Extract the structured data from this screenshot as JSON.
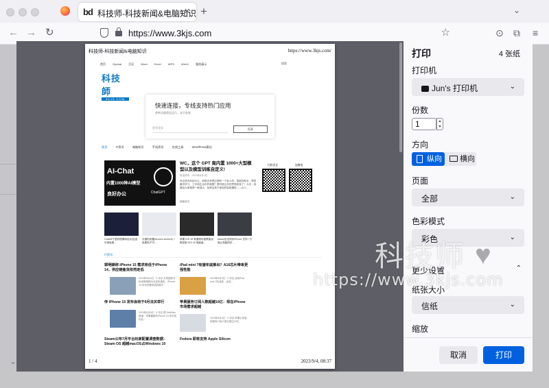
{
  "browser": {
    "tab_title": "科技师-科技新闻&电脑知识",
    "tab_favicon": "bd",
    "tab_close": "×",
    "new_tab": "+",
    "tab_list": "⌄",
    "url": "https://www.3kjs.com",
    "nav": {
      "back": "←",
      "forward": "→",
      "reload": "↻"
    },
    "star": "☆",
    "toolbar_icons": {
      "pocket": "⊙",
      "extensions": "⧉",
      "menu": "≡"
    }
  },
  "preview_page": {
    "header_left": "科技师-科技新闻&电脑知识",
    "header_right": "https://www.3kjs.com/",
    "footer_left": "1 / 4",
    "footer_right": "2023/9/4, 08:37",
    "nav_items": [
      "首页",
      "Openai",
      "日记",
      "Word",
      "Excel",
      "WPS",
      "Win11",
      "服务展示"
    ],
    "search": "搜索",
    "logo_zh": "科技師",
    "logo_en": "3KJS.COM",
    "ad_title": "快速连接，专线支持热门应用",
    "ad_sub": "多种设备稳定运行，永不失联",
    "ad_input": "更多登录",
    "ad_button": "打开",
    "categories": [
      "首页",
      "IT资讯",
      "电脑知识",
      "手机资讯",
      "在线工具",
      "WordPress建站"
    ],
    "featured": {
      "img_big": "AI-Chat",
      "img_mid": "内置1000种AI模型",
      "img_small": "良好办公",
      "img_brand": "ChatGPT",
      "title": "WC，这个 GPT 竟内置 1000+大型模型以及模型训练自定义!",
      "meta": "科技资讯 · 2023年8月4日",
      "desc": "热点资讯科技为主，前是否有想过拥有一个私人的、智能的助手。帮您解决学习、工作和生活中的难题？是时候让你的梦想成真了！今天，我要给大家推荐一款强大、免费且易于使用的智能模型——AI-C…",
      "more": "阅读全文"
    },
    "qr_labels": [
      "扫码关注",
      "加微信"
    ],
    "thumbs": [
      "ChatGPT国内镜像网站大全(含可用免费...",
      "光猫的设置(Arrow's Archive) + 免费电子书...",
      "苹果 iOS 16 有漏洞可被黑客远程控制 iOS 16 电脑版...",
      "steam无法同步iPhone 文件? 只能让电脑同步..."
    ],
    "section_label": "IT资讯",
    "articles": [
      {
        "title": "郭明錤称 iPhone 15 需求将低于iPhone 14，供应链备货依然走低",
        "meta": "2023年8月4日 · 0 评论 天风国际分析师郭明錤今天发布报告，iPhone 15 系列的需求或将弱于..."
      },
      {
        "title": "iPad mini 7有望年底推出？A16芯片带来更强性能",
        "meta": "2023年8月4日 · 0 评论 此前iPad mini 7的消息... 此前..."
      },
      {
        "title": "传 iPhone 15 发布会将于9月法关举行",
        "meta": "2023年8月4日 · 0 评论 据 9to5Mac 报道，苹果最新的iPhone 15 系列发布会..."
      },
      {
        "title": "苹果服务订阅人数超越10亿：现在iPhone市场需求超越",
        "meta": "2023年8月4日 · 0 评论 苹果公司宣布服务订阅人数已超过10亿..."
      },
      {
        "title": "Steam公布7月平台玩家配置调查数据：Steam OS 超越macOS占Windows 10",
        "meta": ""
      },
      {
        "title": "Fedora 即将支持 Apple Silicon",
        "meta": ""
      }
    ]
  },
  "print_panel": {
    "title": "打印",
    "sheets": "4 张纸",
    "printer_label": "打印机",
    "printer_value": "Jun's 打印机",
    "copies_label": "份数",
    "copies_value": "1",
    "orientation_label": "方向",
    "portrait": "纵向",
    "landscape": "横向",
    "pages_label": "页面",
    "pages_value": "全部",
    "color_label": "色彩模式",
    "color_value": "彩色",
    "less_settings": "更少设置",
    "paper_label": "纸张大小",
    "paper_value": "信纸",
    "scale_label": "缩放",
    "cancel": "取消",
    "print": "打印"
  },
  "watermark": {
    "line1": "科技师",
    "line2": "https://www.3kjs.com"
  },
  "colors": {
    "accent": "#0061e0",
    "logo_blue": "#0f79c3",
    "preview_bg": "#5e5e66"
  }
}
